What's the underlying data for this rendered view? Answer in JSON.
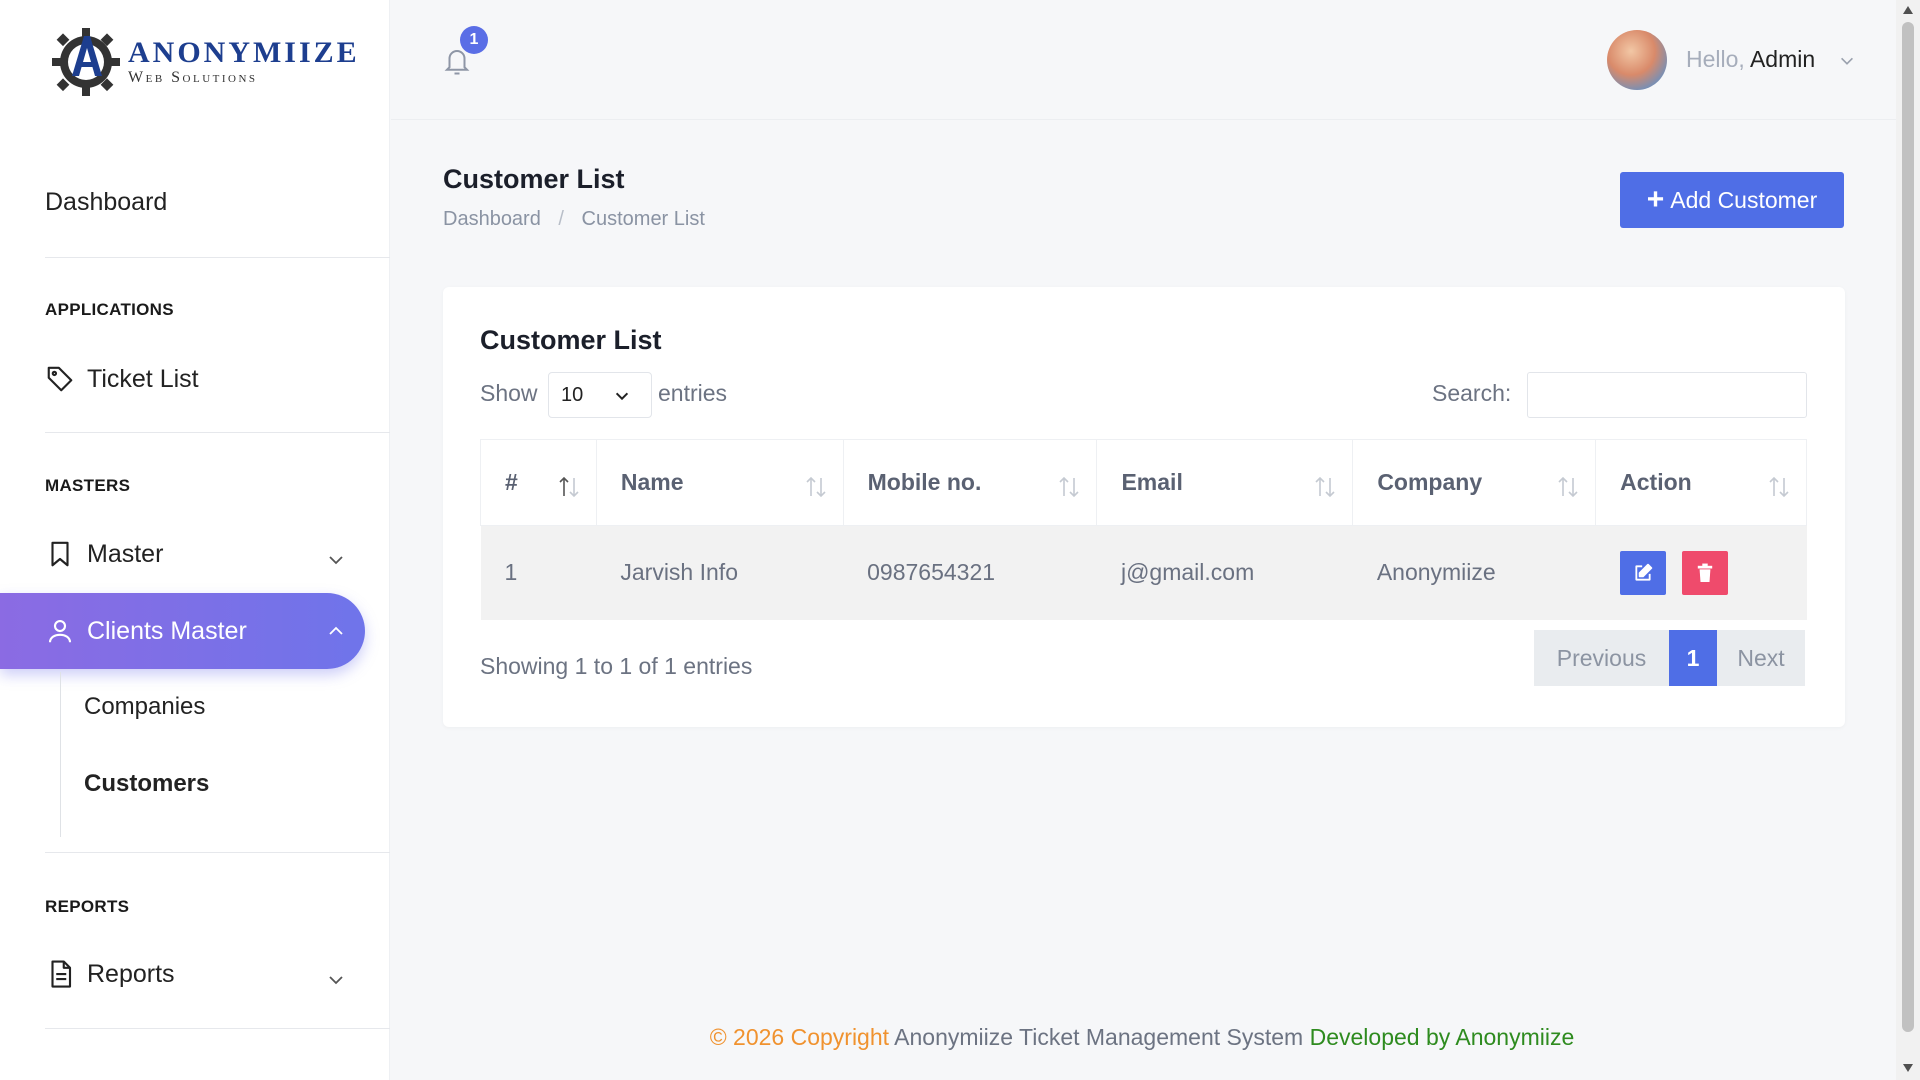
{
  "brand": {
    "logo_main": "ANONYMIIZE",
    "logo_sub": "Web Solutions"
  },
  "sidebar": {
    "dashboard": "Dashboard",
    "sections": {
      "applications": "APPLICATIONS",
      "masters": "MASTERS",
      "reports": "REPORTS"
    },
    "items": {
      "ticket_list": "Ticket List",
      "master": "Master",
      "clients_master": "Clients Master",
      "companies": "Companies",
      "customers": "Customers",
      "reports": "Reports"
    }
  },
  "topbar": {
    "notification_count": "1",
    "hello_prefix": "Hello,",
    "user_name": "Admin"
  },
  "page": {
    "title": "Customer List",
    "breadcrumb": [
      "Dashboard",
      "Customer List"
    ],
    "add_button": "Add Customer"
  },
  "card": {
    "title": "Customer List",
    "show_label": "Show",
    "entries_value": "10",
    "entries_label": "entries",
    "search_label": "Search:",
    "search_value": ""
  },
  "table": {
    "columns": [
      "#",
      "Name",
      "Mobile no.",
      "Email",
      "Company",
      "Action"
    ],
    "rows": [
      {
        "index": "1",
        "name": "Jarvish Info",
        "mobile": "0987654321",
        "email": "j@gmail.com",
        "company": "Anonymiize"
      }
    ]
  },
  "pagination": {
    "summary": "Showing 1 to 1 of 1 entries",
    "previous": "Previous",
    "current": "1",
    "next": "Next"
  },
  "footer": {
    "copyright": "© 2026 Copyright",
    "system": "Anonymiize Ticket Management System",
    "developed": "Developed by Anonymiize"
  },
  "colors": {
    "accent": "#4f6ee6",
    "active_gradient_start": "#8b6be3",
    "active_gradient_end": "#6f74ea",
    "danger": "#ef4b6c",
    "footer_orange": "#f0922f",
    "footer_green": "#2e8b1f"
  }
}
